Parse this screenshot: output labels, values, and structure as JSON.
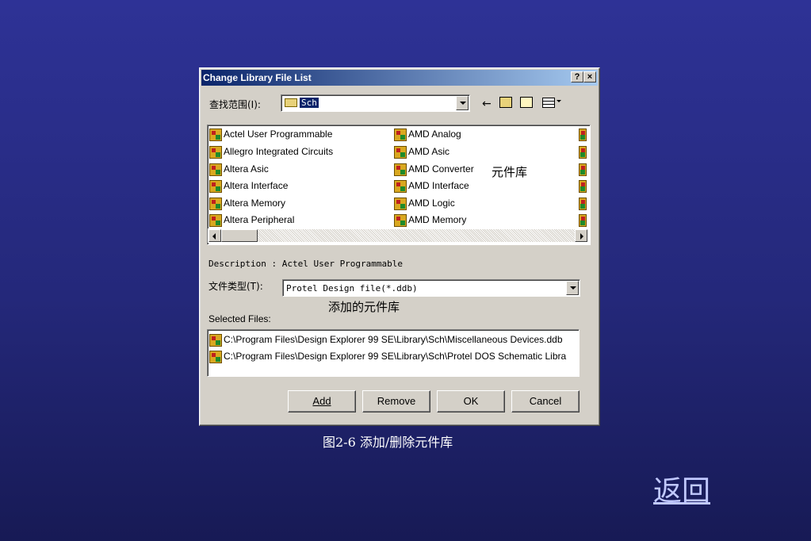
{
  "dialog": {
    "title": "Change Library File List",
    "help_label": "?",
    "close_label": "×",
    "look_in_label": "查找范围(I):",
    "look_in_value": "Sch",
    "file_list": {
      "col1": [
        "Actel User Programmable",
        "Allegro Integrated Circuits",
        "Altera Asic",
        "Altera Interface",
        "Altera Memory",
        "Altera Peripheral"
      ],
      "col2": [
        "AMD Analog",
        "AMD Asic",
        "AMD Converter",
        "AMD Interface",
        "AMD Logic",
        "AMD Memory"
      ]
    },
    "description": "Description : Actel User Programmable",
    "file_type_label": "文件类型(T):",
    "file_type_value": "Protel Design file(*.ddb)",
    "selected_files_label": "Selected Files:",
    "selected_files": [
      "C:\\Program Files\\Design Explorer 99 SE\\Library\\Sch\\Miscellaneous Devices.ddb",
      "C:\\Program Files\\Design Explorer 99 SE\\Library\\Sch\\Protel DOS Schematic Libra"
    ],
    "buttons": {
      "add": "Add",
      "remove": "Remove",
      "ok": "OK",
      "cancel": "Cancel"
    }
  },
  "annotations": {
    "library": "元件库",
    "added_library": "添加的元件库"
  },
  "caption": "图2-6 添加/删除元件库",
  "back_link": "返回"
}
